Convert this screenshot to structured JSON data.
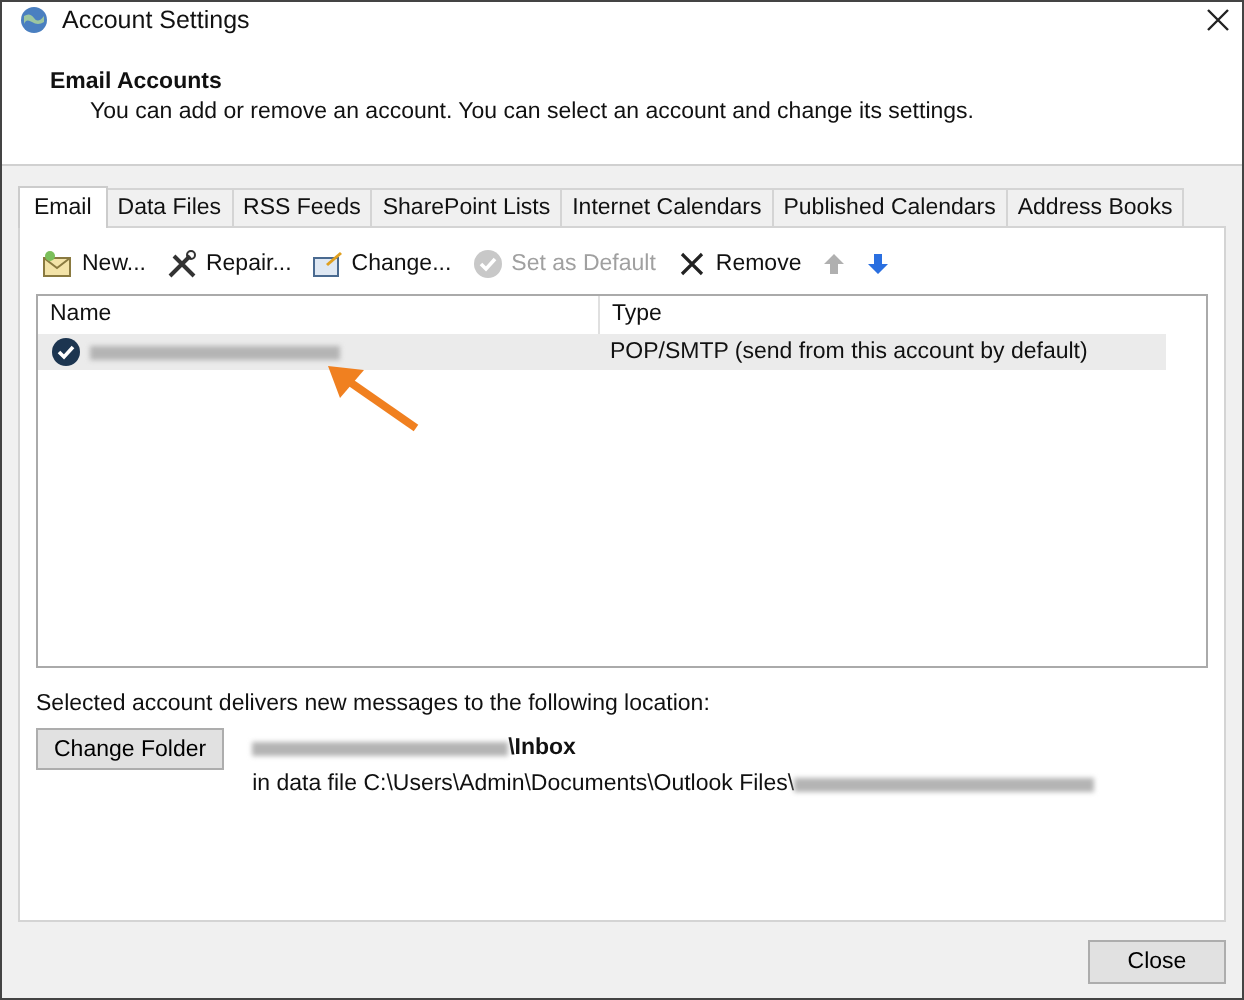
{
  "window": {
    "title": "Account Settings"
  },
  "header": {
    "title": "Email Accounts",
    "description": "You can add or remove an account. You can select an account and change its settings."
  },
  "tabs": [
    {
      "label": "Email",
      "selected": true
    },
    {
      "label": "Data Files",
      "selected": false
    },
    {
      "label": "RSS Feeds",
      "selected": false
    },
    {
      "label": "SharePoint Lists",
      "selected": false
    },
    {
      "label": "Internet Calendars",
      "selected": false
    },
    {
      "label": "Published Calendars",
      "selected": false
    },
    {
      "label": "Address Books",
      "selected": false
    }
  ],
  "toolbar": [
    {
      "kind": "new",
      "label": "New...",
      "disabled": false
    },
    {
      "kind": "repair",
      "label": "Repair...",
      "disabled": false
    },
    {
      "kind": "change",
      "label": "Change...",
      "disabled": false
    },
    {
      "kind": "default",
      "label": "Set as Default",
      "disabled": true
    },
    {
      "kind": "remove",
      "label": "Remove",
      "disabled": false
    },
    {
      "kind": "up",
      "disabled": true
    },
    {
      "kind": "down",
      "disabled": false
    }
  ],
  "table": {
    "columns": [
      "Name",
      "Type"
    ],
    "rows": [
      {
        "default": true,
        "selected": true,
        "type": "POP/SMTP (send from this account by default)"
      }
    ]
  },
  "delivery": {
    "label": "Selected account delivers new messages to the following location:",
    "button": "Change Folder",
    "folder": "\\Inbox",
    "data_file": "in data file C:\\Users\\Admin\\Documents\\Outlook Files\\"
  },
  "buttons": [
    "Close"
  ]
}
